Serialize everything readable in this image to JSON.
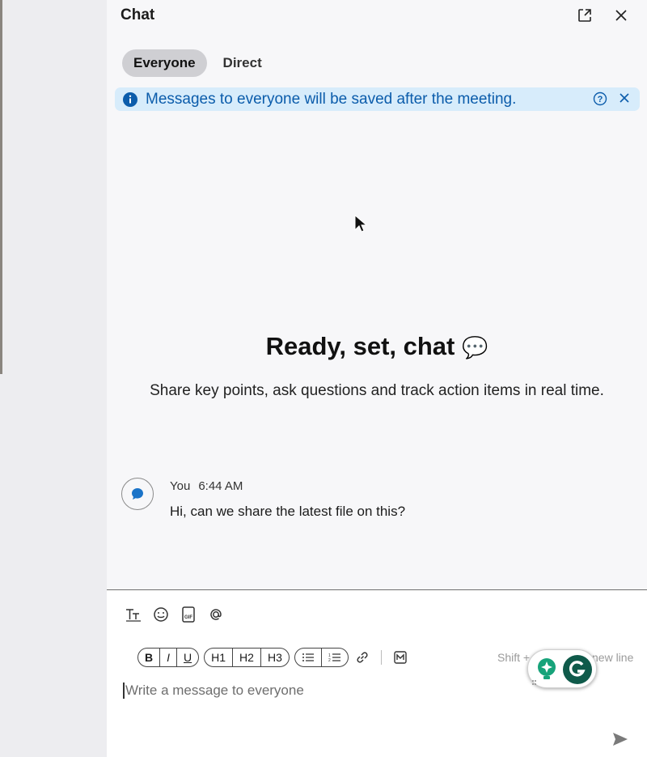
{
  "header": {
    "title": "Chat",
    "popout_icon": "popout-icon",
    "close_icon": "close-icon"
  },
  "tabs": [
    {
      "label": "Everyone",
      "active": true
    },
    {
      "label": "Direct",
      "active": false
    }
  ],
  "banner": {
    "text": "Messages to everyone will be saved after the meeting.",
    "info_icon": "info-icon",
    "help_icon": "help-icon",
    "close_icon": "close-icon"
  },
  "empty_state": {
    "title": "Ready, set, chat",
    "emoji": "💬",
    "subtitle": "Share key points, ask questions and track action items in real time."
  },
  "message": {
    "author": "You",
    "time": "6:44 AM",
    "text": "Hi, can we share the latest file on this?"
  },
  "composer": {
    "tools": [
      "text-format-icon",
      "emoji-icon",
      "gif-icon",
      "mention-icon"
    ],
    "format_groups": [
      [
        "B",
        "I",
        "U"
      ],
      [
        "H1",
        "H2",
        "H3"
      ]
    ],
    "hint_left": "Shift +",
    "hint_right": "new line",
    "placeholder": "Write a message to everyone",
    "send_icon": "send-icon"
  },
  "colors": {
    "accent": "#0b5cab",
    "banner_bg": "#d7ecfb",
    "active_tab": "#cfcfd3"
  }
}
